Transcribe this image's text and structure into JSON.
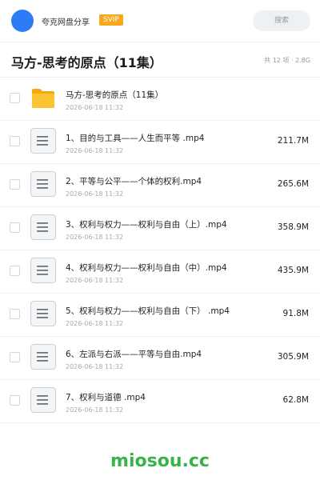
{
  "header": {
    "brand": "夸克网盘分享",
    "badge": "SVIP",
    "search_placeholder": "搜索"
  },
  "title_bar": {
    "title": "马方-思考的原点（11集）",
    "meta": "共 12 项 · 2.8G"
  },
  "items": [
    {
      "type": "folder",
      "name": "马方-思考的原点（11集）",
      "date": "2026-06-18 11:32",
      "size": ""
    },
    {
      "type": "file",
      "name": "1、目的与工具——人生而平等 .mp4",
      "date": "2026-06-18 11:32",
      "size": "211.7M"
    },
    {
      "type": "file",
      "name": "2、平等与公平——个体的权利.mp4",
      "date": "2026-06-18 11:32",
      "size": "265.6M"
    },
    {
      "type": "file",
      "name": "3、权利与权力——权利与自由（上）.mp4",
      "date": "2026-06-18 11:32",
      "size": "358.9M"
    },
    {
      "type": "file",
      "name": "4、权利与权力——权利与自由（中）.mp4",
      "date": "2026-06-18 11:32",
      "size": "435.9M"
    },
    {
      "type": "file",
      "name": "5、权利与权力——权利与自由（下） .mp4",
      "date": "2026-06-18 11:32",
      "size": "91.8M"
    },
    {
      "type": "file",
      "name": "6、左派与右派——平等与自由.mp4",
      "date": "2026-06-18 11:32",
      "size": "305.9M"
    },
    {
      "type": "file",
      "name": "7、权利与道德 .mp4",
      "date": "2026-06-18 11:32",
      "size": "62.8M"
    }
  ],
  "footer": {
    "watermark": "miosou.cc"
  },
  "colors": {
    "accent": "#2d7cf6",
    "badge": "#f7a81b",
    "folder": "#fbc02d",
    "watermark": "#37b34a"
  }
}
